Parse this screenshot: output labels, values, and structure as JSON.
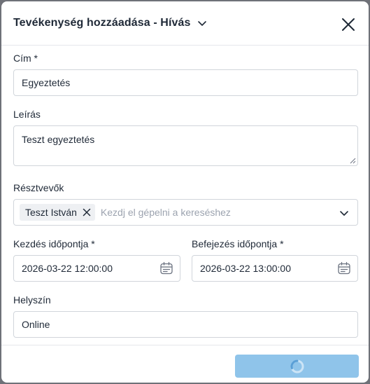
{
  "modal": {
    "title": "Tevékenység hozzáadása - Hívás"
  },
  "form": {
    "cim": {
      "label": "Cím *",
      "value": "Egyeztetés"
    },
    "leiras": {
      "label": "Leírás",
      "value": "Teszt egyeztetés"
    },
    "resztvevok": {
      "label": "Résztvevők",
      "tags": [
        "Teszt István"
      ],
      "placeholder": "Kezdj el gépelni a kereséshez"
    },
    "kezdes": {
      "label": "Kezdés időpontja *",
      "value": "2026-03-22 12:00:00"
    },
    "befejezes": {
      "label": "Befejezés időpontja *",
      "value": "2026-03-22 13:00:00"
    },
    "helyszin": {
      "label": "Helyszín",
      "value": "Online"
    }
  },
  "footer": {
    "submit_state": "loading",
    "submit_color": "#8fc4ea"
  },
  "icons": {
    "title_chevron": "chevron-down-icon",
    "close": "close-icon",
    "tag_remove": "close-icon",
    "select_chevron": "chevron-down-icon",
    "calendar": "calendar-icon",
    "spinner": "loading-spinner-icon"
  }
}
